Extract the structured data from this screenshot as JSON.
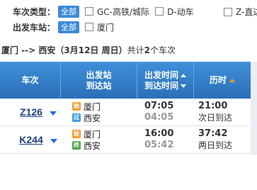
{
  "filters": {
    "train_type": {
      "label": "车次类型：",
      "all_chip": "全部",
      "options": [
        "GC-高铁/城际",
        "D-动车",
        "Z-直达"
      ]
    },
    "departure_station": {
      "label": "出发车站：",
      "all_chip": "全部",
      "options": [
        "厦门"
      ]
    }
  },
  "route": {
    "text": "厦门 --> 西安（3月12日  周日）",
    "count_prefix": "共计",
    "count": "2",
    "count_suffix": "个车次"
  },
  "table": {
    "headers": {
      "train": "车次",
      "stations_line1": "出发站",
      "stations_line2": "到达站",
      "time_line1": "出发时间",
      "time_line2": "到达时间",
      "duration": "历时"
    },
    "rows": [
      {
        "train": "Z126",
        "from_badge": "始",
        "from": "厦门",
        "to_badge": "过",
        "to": "西安",
        "depart": "07:05",
        "arrive": "04:05",
        "duration": "21:00",
        "arrival_day": "次日到达"
      },
      {
        "train": "K244",
        "from_badge": "始",
        "from": "厦门",
        "to_badge": "终",
        "to": "西安",
        "depart": "16:00",
        "arrive": "05:42",
        "duration": "37:42",
        "arrival_day": "两日到达"
      }
    ]
  },
  "colors": {
    "header_blue": "#2f7dcc",
    "chip_blue": "#3c8ad8",
    "train_link": "#1d3f7e",
    "badge_start": "#f0a030",
    "badge_pass": "#3aa0e0",
    "badge_end": "#4ba84b",
    "sort_active": "#f0a020"
  }
}
